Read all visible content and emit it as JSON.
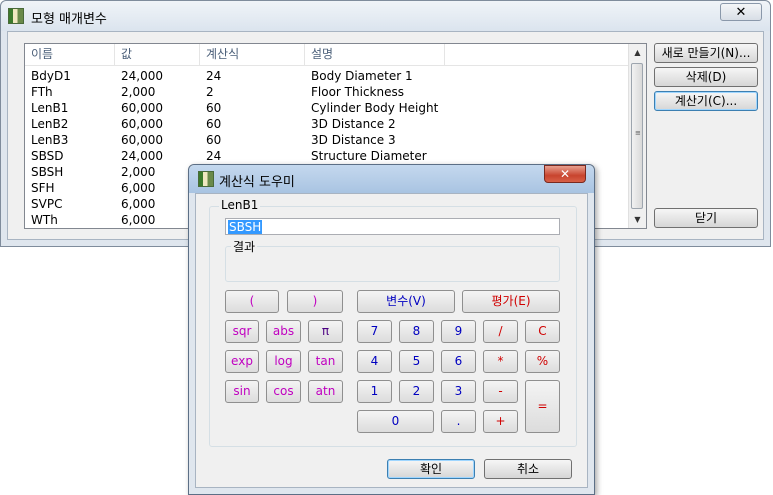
{
  "main_window": {
    "title": "모형 매개변수",
    "close": "✕",
    "columns": [
      "이름",
      "값",
      "계산식",
      "설명"
    ],
    "rows": [
      {
        "name": "BdyD1",
        "value": "24,000",
        "formula": "24",
        "desc": "Body Diameter 1"
      },
      {
        "name": "FTh",
        "value": "2,000",
        "formula": "2",
        "desc": "Floor Thickness"
      },
      {
        "name": "LenB1",
        "value": "60,000",
        "formula": "60",
        "desc": "Cylinder Body Height"
      },
      {
        "name": "LenB2",
        "value": "60,000",
        "formula": "60",
        "desc": "3D Distance 2"
      },
      {
        "name": "LenB3",
        "value": "60,000",
        "formula": "60",
        "desc": "3D Distance 3"
      },
      {
        "name": "SBSD",
        "value": "24,000",
        "formula": "24",
        "desc": "Structure Diameter"
      },
      {
        "name": "SBSH",
        "value": "2,000",
        "formula": "",
        "desc": ""
      },
      {
        "name": "SFH",
        "value": "6,000",
        "formula": "",
        "desc": ""
      },
      {
        "name": "SVPC",
        "value": "6,000",
        "formula": "",
        "desc": ""
      },
      {
        "name": "WTh",
        "value": "6,000",
        "formula": "",
        "desc": ""
      }
    ],
    "buttons": {
      "new": "새로 만들기(N)...",
      "delete": "삭제(D)",
      "calculator": "계산기(C)...",
      "close": "닫기"
    }
  },
  "dialog": {
    "title": "계산식 도우미",
    "close": "✕",
    "param_label": "LenB1",
    "expression": "SBSH",
    "result_label": "결과",
    "result_value": "",
    "keys": {
      "lparen": "(",
      "rparen": ")",
      "variable": "변수(V)",
      "evaluate": "평가(E)",
      "sqr": "sqr",
      "abs": "abs",
      "pi": "π",
      "exp": "exp",
      "log": "log",
      "tan": "tan",
      "sin": "sin",
      "cos": "cos",
      "atn": "atn",
      "d7": "7",
      "d8": "8",
      "d9": "9",
      "div": "/",
      "clear": "C",
      "d4": "4",
      "d5": "5",
      "d6": "6",
      "mul": "*",
      "mod": "%",
      "d1": "1",
      "d2": "2",
      "d3": "3",
      "sub": "-",
      "eq": "=",
      "d0": "0",
      "dot": ".",
      "add": "+"
    },
    "ok": "확인",
    "cancel": "취소"
  }
}
